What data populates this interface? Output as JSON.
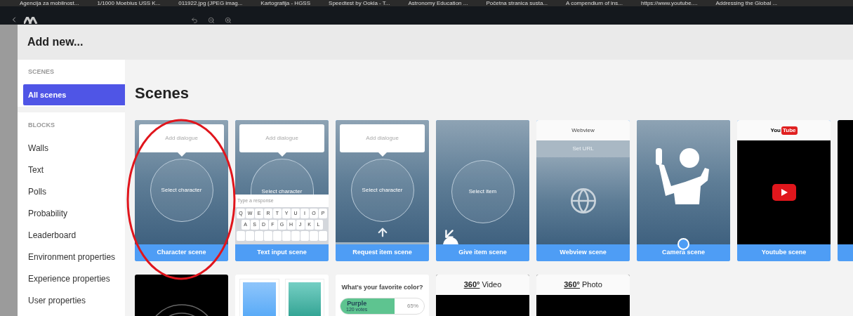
{
  "bookmarks": [
    "Agencija za mobilnost...",
    "1/1000 Moebius USS K...",
    "011922.jpg (JPEG imag...",
    "Kartografija - HGSS",
    "Speedtest by Ookla - T...",
    "Astronomy Education ...",
    "Početna stranica susta...",
    "A compendium of ins...",
    "https://www.youtube....",
    "Addressing the Global ..."
  ],
  "modal": {
    "title": "Add new...",
    "sidebar": [
      {
        "heading": "SCENES",
        "items": [
          {
            "label": "All scenes",
            "selected": true
          }
        ]
      },
      {
        "heading": "BLOCKS",
        "items": [
          {
            "label": "Walls",
            "selected": false
          },
          {
            "label": "Text",
            "selected": false
          },
          {
            "label": "Polls",
            "selected": false
          },
          {
            "label": "Probability",
            "selected": false
          },
          {
            "label": "Leaderboard",
            "selected": false
          },
          {
            "label": "Environment properties",
            "selected": false
          },
          {
            "label": "Experience properties",
            "selected": false
          },
          {
            "label": "User properties",
            "selected": false
          }
        ]
      }
    ],
    "heading": "Scenes",
    "cards": [
      {
        "kind": "character",
        "dialogue": "Add dialogue",
        "circle_text": "Select character",
        "label": "Character scene"
      },
      {
        "kind": "text_input",
        "dialogue": "Add dialogue",
        "circle_text": "Select character",
        "placeholder": "Type a response",
        "keys": [
          [
            "Q",
            "W",
            "E",
            "R",
            "T",
            "Y",
            "U",
            "I",
            "O",
            "P"
          ],
          [
            "A",
            "S",
            "D",
            "F",
            "G",
            "H",
            "J",
            "K",
            "L"
          ]
        ],
        "label": "Text input scene"
      },
      {
        "kind": "request",
        "dialogue": "Add dialogue",
        "circle_text": "Select character",
        "label": "Request item scene"
      },
      {
        "kind": "give",
        "circle_text": "Select item",
        "label": "Give item scene"
      },
      {
        "kind": "webview",
        "header": "Webview",
        "url_placeholder": "Set URL",
        "label": "Webview scene"
      },
      {
        "kind": "camera",
        "label": "Camera scene"
      },
      {
        "kind": "youtube",
        "logo": [
          "You",
          "Tube"
        ],
        "label": "Youtube scene"
      },
      {
        "kind": "dark"
      },
      {
        "kind": "rings"
      },
      {
        "kind": "walls"
      },
      {
        "kind": "poll",
        "question": "What's your favorite color?",
        "option": "Purple",
        "votes": "120 votes",
        "percent": "65%",
        "level": 0.65
      },
      {
        "kind": "pano",
        "badge": "360°",
        "title": "Video"
      },
      {
        "kind": "pano",
        "badge": "360°",
        "title": "Photo"
      }
    ]
  }
}
